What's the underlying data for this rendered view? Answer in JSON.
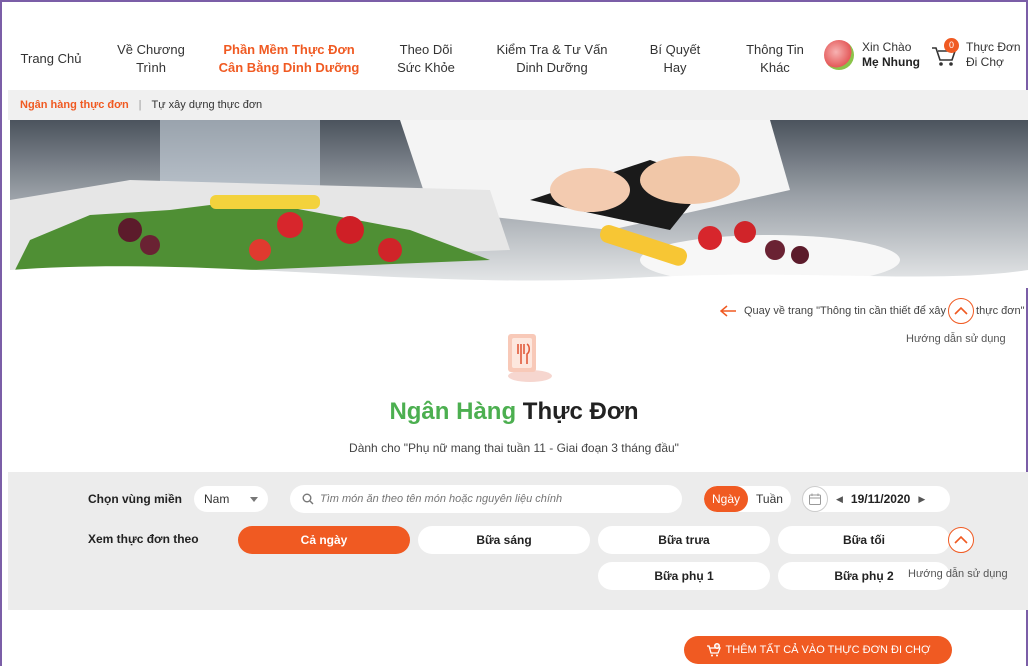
{
  "nav": {
    "items": [
      {
        "label": "Trang Chủ"
      },
      {
        "label": "Về Chương\nTrình"
      },
      {
        "label": "Phần Mềm Thực Đơn\nCân Bằng Dinh Dưỡng"
      },
      {
        "label": "Theo Dõi\nSức Khỏe"
      },
      {
        "label": "Kiểm Tra & Tư Vấn\nDinh Dưỡng"
      },
      {
        "label": "Bí Quyết\nHay"
      },
      {
        "label": "Thông Tin\nKhác"
      }
    ],
    "greeting": "Xin Chào",
    "user_name": "Mẹ Nhung",
    "cart_count": "0",
    "cart_label": "Thực Đơn\nĐi Chợ"
  },
  "subnav": {
    "current": "Ngân hàng thực đơn",
    "other": "Tự xây dựng thực đơn"
  },
  "backlink": {
    "text": "Quay về trang \"Thông tin cần thiết để xây",
    "text_tail": "thực đơn\""
  },
  "help_label": "Hướng dẫn sử dụng",
  "heading": {
    "green": "Ngân Hàng",
    "dark": "Thực Đơn",
    "subtitle": "Dành cho \"Phụ nữ mang thai tuần 11 - Giai đoạn 3 tháng đầu\""
  },
  "filters": {
    "region_label": "Chọn vùng miền",
    "region_value": "Nam",
    "search_placeholder": "Tìm món ăn theo tên món hoặc nguyên liệu chính",
    "mode_day": "Ngày",
    "mode_week": "Tuần",
    "date": "19/11/2020",
    "view_label": "Xem thực đơn theo",
    "meals": [
      "Cả ngày",
      "Bữa sáng",
      "Bữa trưa",
      "Bữa tối",
      "Bữa phụ 1",
      "Bữa phụ 2"
    ]
  },
  "add_all_button": "THÊM TẤT CẢ VÀO THỰC ĐƠN ĐI CHỢ",
  "colors": {
    "accent": "#f05a22",
    "green": "#4caf50",
    "panel": "#ececec"
  }
}
